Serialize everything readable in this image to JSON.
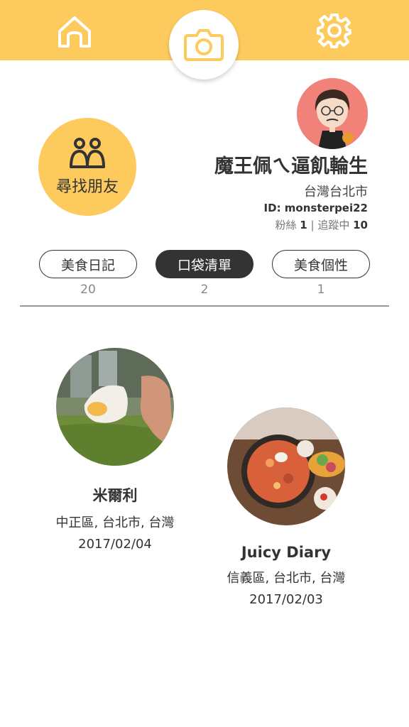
{
  "header": {
    "home_icon": "home-icon",
    "camera_icon": "camera-icon",
    "settings_icon": "gear-icon",
    "accent_color": "#fdcb5d"
  },
  "find_friends": {
    "label": "尋找朋友",
    "icon": "friends-icon"
  },
  "profile": {
    "name": "魔王佩ㄟ逼飢輪生",
    "location": "台灣台北市",
    "id_label": "ID: monsterpei22",
    "followers_label": "粉絲",
    "followers_count": "1",
    "separator": "|",
    "following_label": "追蹤中",
    "following_count": "10"
  },
  "tabs": [
    {
      "label": "美食日記",
      "count": "20",
      "active": false
    },
    {
      "label": "口袋清單",
      "count": "2",
      "active": true
    },
    {
      "label": "美食個性",
      "count": "1",
      "active": false
    }
  ],
  "cards": [
    {
      "title": "米爾利",
      "place": "中正區, 台北市, 台灣",
      "date": "2017/02/04"
    },
    {
      "title": "Juicy Diary",
      "place": "信義區, 台北市, 台灣",
      "date": "2017/02/03"
    }
  ]
}
